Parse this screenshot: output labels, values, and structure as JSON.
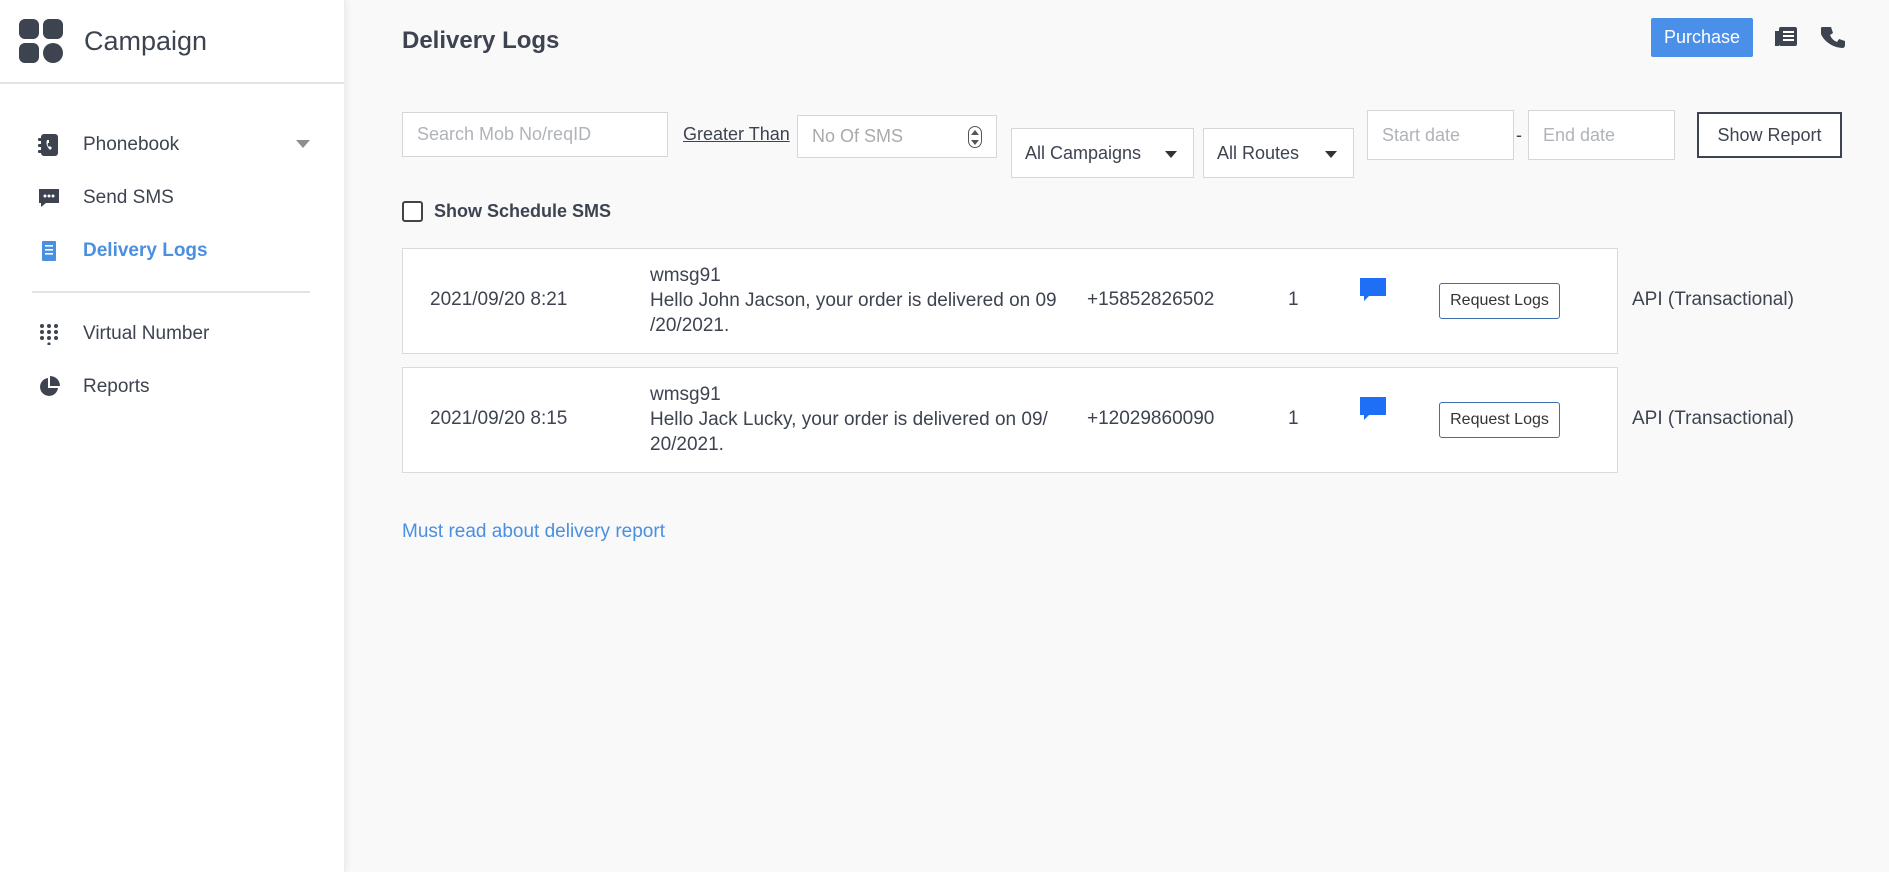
{
  "app": {
    "title": "Campaign"
  },
  "colors": {
    "accent": "#4a8fe0",
    "purchase": "#4a8fe8",
    "chat_icon": "#1e6ff5",
    "text": "#3d4450"
  },
  "sidebar": {
    "items": [
      {
        "label": "Phonebook",
        "icon": "phonebook-icon",
        "has_dropdown": true
      },
      {
        "label": "Send SMS",
        "icon": "chat-icon"
      },
      {
        "label": "Delivery Logs",
        "icon": "document-icon",
        "active": true
      },
      {
        "label": "Virtual Number",
        "icon": "dialpad-icon"
      },
      {
        "label": "Reports",
        "icon": "pie-chart-icon"
      }
    ]
  },
  "header": {
    "title": "Delivery Logs",
    "purchase_label": "Purchase",
    "icons": [
      "contact-list-icon",
      "phone-icon"
    ]
  },
  "filters": {
    "search_placeholder": "Search Mob No/reqID",
    "greater_than_label": "Greater Than",
    "sms_count_placeholder": "No Of SMS",
    "campaign_select": "All Campaigns",
    "route_select": "All Routes",
    "start_date_placeholder": "Start date",
    "date_separator": "-",
    "end_date_placeholder": "End date",
    "show_report_label": "Show Report"
  },
  "schedule": {
    "label": "Show Schedule SMS",
    "checked": false
  },
  "logs": [
    {
      "date": "2021/09/20 8:21",
      "sender": "wmsg91",
      "message": "Hello John Jacson, your order is delivered on 09/20/2021.",
      "message_line1": "Hello John Jacson, your order is delivered on 09",
      "message_line2": "/20/2021.",
      "phone": "+15852826502",
      "count": "1",
      "request_label": "Request Logs",
      "route": "API (Transactional)"
    },
    {
      "date": "2021/09/20 8:15",
      "sender": "wmsg91",
      "message": "Hello Jack Lucky, your order is delivered on 09/20/2021.",
      "message_line1": "Hello Jack Lucky, your order is delivered on 09/",
      "message_line2": "20/2021.",
      "phone": "+12029860090",
      "count": "1",
      "request_label": "Request Logs",
      "route": "API (Transactional)"
    }
  ],
  "footer_link": "Must read about delivery report"
}
